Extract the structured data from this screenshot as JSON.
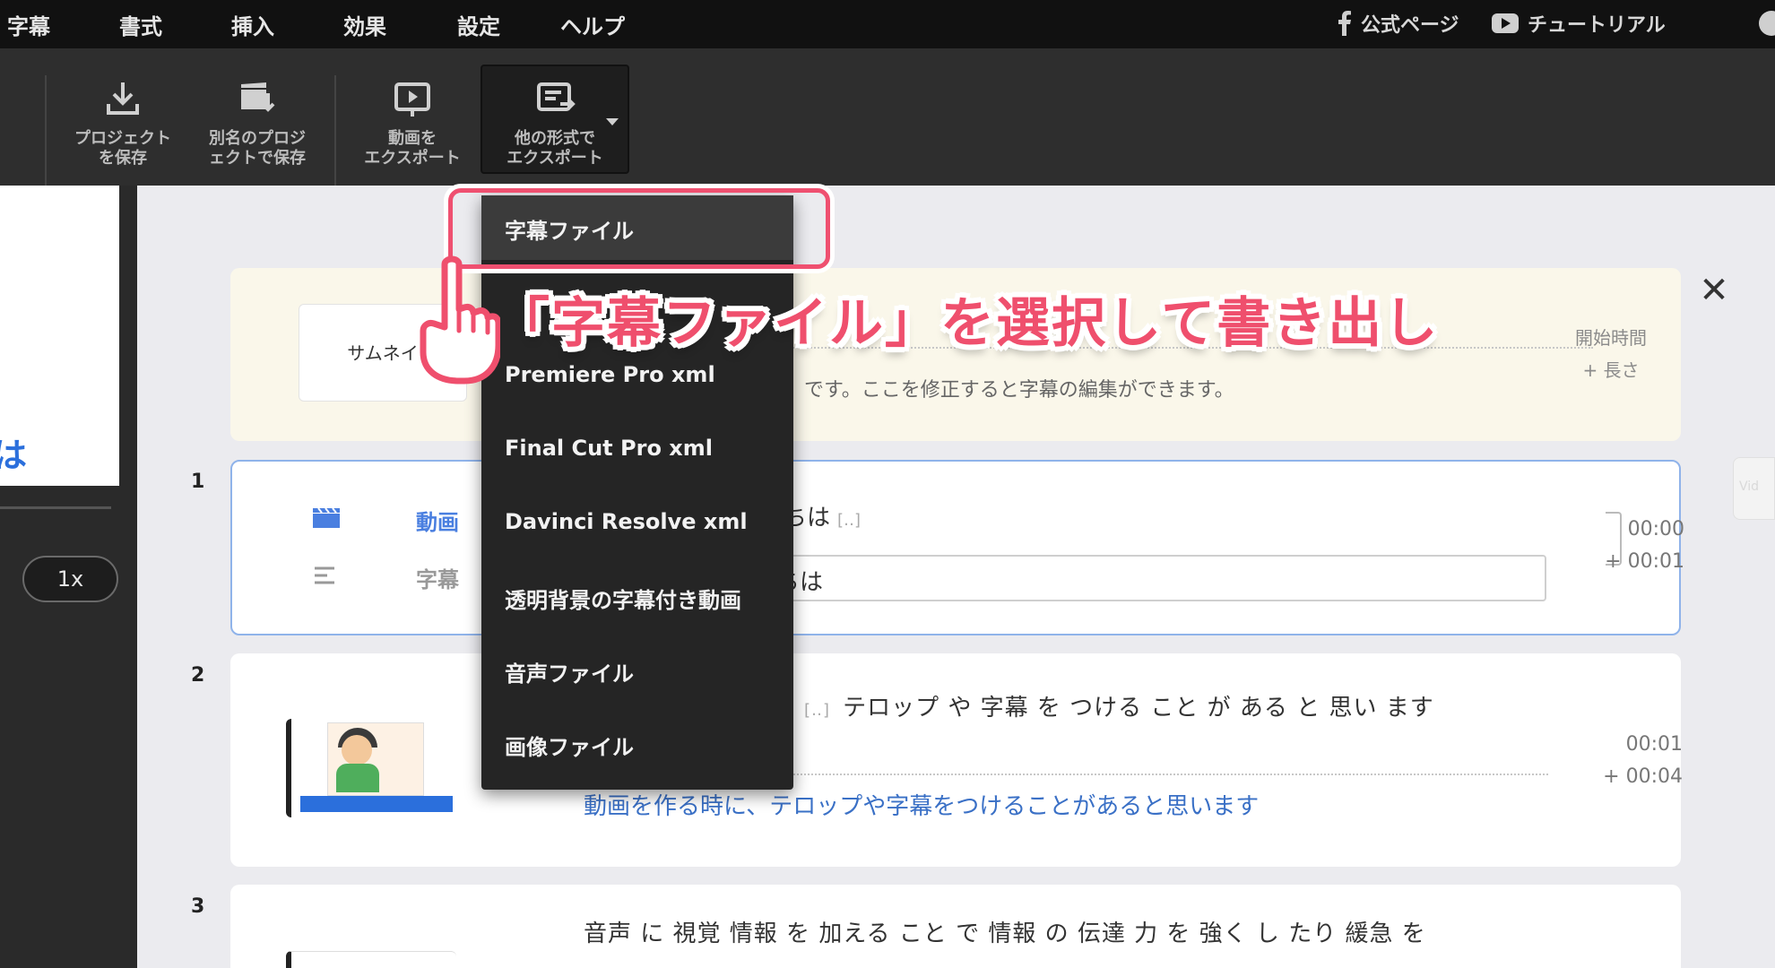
{
  "menubar": {
    "items": [
      "字幕",
      "書式",
      "挿入",
      "効果",
      "設定",
      "ヘルプ"
    ],
    "official_page": "公式ページ",
    "tutorial": "チュートリアル"
  },
  "toolbar": {
    "save_project": "プロジェクト\nを保存",
    "save_as": "別名のプロジ\nェクトで保存",
    "export_video": "動画を\nエクスポート",
    "export_other": "他の形式で\nエクスポート"
  },
  "left": {
    "speed": "1x",
    "preview_glyph": "は"
  },
  "header_row": {
    "thumbnail_label": "サムネイ",
    "hint": "です。ここを修正すると字幕の編集ができます。",
    "time_start": "開始時間",
    "time_length": "+ 長さ"
  },
  "rows": [
    {
      "num": "1",
      "video_label": "動画",
      "subtitle_label": "字幕",
      "speech_text": "ちは",
      "speech_gap": "[‥]",
      "input_text": "ちは",
      "start": "00:00",
      "length": "+ 00:01"
    },
    {
      "num": "2",
      "speech_gap": "[‥]",
      "speech_text": "テロップ や 字幕 を つける こと が ある と 思い ます",
      "caption": "動画を作る時に、テロップや字幕をつけることがあると思います",
      "start": "00:01",
      "length": "+ 00:04"
    },
    {
      "num": "3",
      "speech_text": "音声 に 視覚 情報 を 加える こと で 情報 の 伝達 力 を 強く し たり 緩急 を"
    }
  ],
  "dropdown": {
    "items": [
      "字幕ファイル",
      "Premiere Pro xml",
      "Final Cut Pro xml",
      "Davinci Resolve xml",
      "透明背景の字幕付き動画",
      "音声ファイル",
      "画像ファイル"
    ]
  },
  "annotation": {
    "text": "「字幕ファイル」を選択して書き出し"
  },
  "colors": {
    "accent_pink": "#ef4f6d",
    "link_blue": "#3a70c6",
    "selected_border": "#8fb3ea"
  }
}
